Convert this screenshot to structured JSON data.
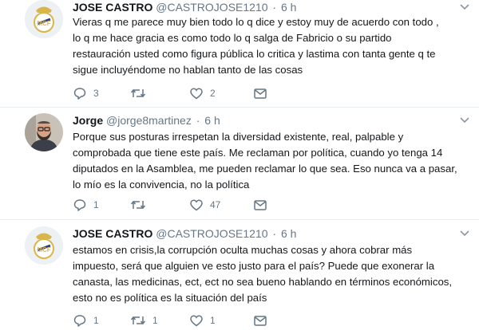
{
  "tweets": [
    {
      "name": "JOSE CASTRO",
      "handle": "@CASTROJOSE1210",
      "separator": "·",
      "time": "6 h",
      "text": "Vieras q me parece muy bien todo lo q dice y estoy muy de acuerdo con todo ,\nlo q me hace gracia es como todo lo q salga de Fabricio o su partido\nrestauración usted como figura pública lo critica y lastima con tanta gente q te\nsigue incluyéndome no hablan tanto de las cosas",
      "reply_count": "3",
      "retweet_count": "",
      "like_count": "2",
      "avatar": "real-madrid-crest-avatar"
    },
    {
      "name": "Jorge",
      "handle": "@jorge8martinez",
      "separator": "·",
      "time": "6 h",
      "text": "Porque sus posturas irrespetan la diversidad existente, real, palpable y\ncomprobada que tiene este país. Me reclaman por política, cuando yo tenga 14\ndiputados en la Asamblea, me pueden reclamar lo que sea. Eso nunca va a pasar,\nlo mío es la convivencia, no la política",
      "reply_count": "1",
      "retweet_count": "",
      "like_count": "47",
      "avatar": "man-with-glasses-photo-avatar"
    },
    {
      "name": "JOSE CASTRO",
      "handle": "@CASTROJOSE1210",
      "separator": "·",
      "time": "6 h",
      "text": "estamos  en crisis,la corrupción oculta muchas cosas y ahora cobrar más\nimpuesto, será que alguien ve esto justo para el país? Puede que exonerar la\ncanasta, las medicinas, ect, ect no sea bueno hablando en términos económicos,\nesto no es política es la situación del país",
      "reply_count": "1",
      "retweet_count": "1",
      "like_count": "1",
      "avatar": "real-madrid-crest-avatar"
    }
  ],
  "colors": {
    "text": "#14171a",
    "secondary": "#657786",
    "divider": "#e6ecf0",
    "crest_gold": "#d9b64a",
    "crest_blue": "#2a3f8f"
  },
  "icons": [
    "reply-icon",
    "retweet-icon",
    "like-icon",
    "direct-message-icon",
    "chevron-down-icon"
  ]
}
